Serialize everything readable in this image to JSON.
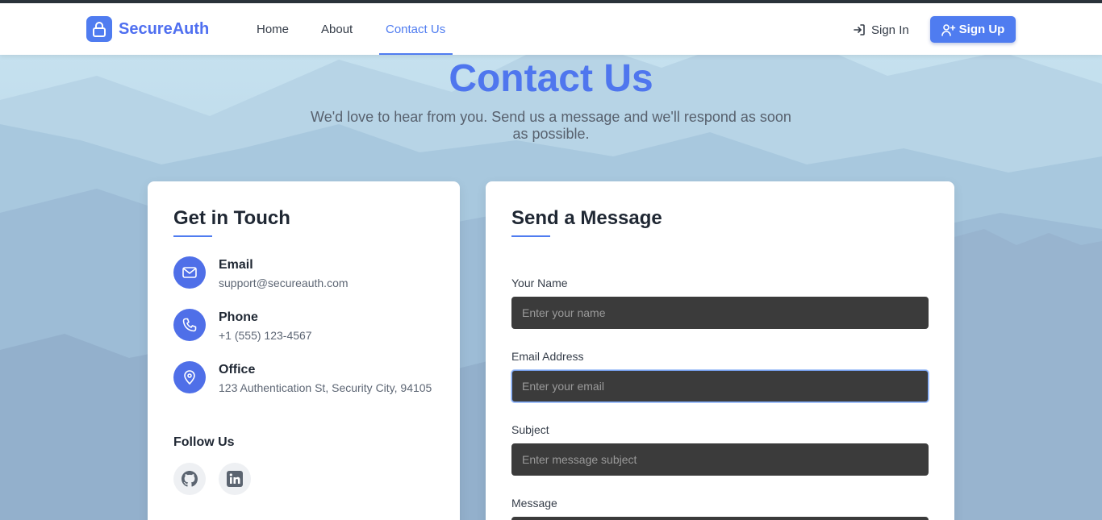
{
  "colors": {
    "accent": "#4f7cf0",
    "title": "#4f76ee",
    "input_bg": "#3b3b3b",
    "page_bg": "#a9c9dd"
  },
  "brand": {
    "name": "SecureAuth",
    "icon": "lock-icon"
  },
  "nav": {
    "links": [
      {
        "label": "Home",
        "active": false
      },
      {
        "label": "About",
        "active": false
      },
      {
        "label": "Contact Us",
        "active": true
      }
    ],
    "sign_in": {
      "label": "Sign In",
      "icon": "sign-in-icon"
    },
    "sign_up": {
      "label": "Sign Up",
      "icon": "user-plus-icon"
    }
  },
  "hero": {
    "title": "Contact Us",
    "subtitle": "We'd love to hear from you. Send us a message and we'll respond as soon as possible."
  },
  "contact_info": {
    "title": "Get in Touch",
    "items": [
      {
        "label": "Email",
        "value": "support@secureauth.com",
        "icon": "mail-icon"
      },
      {
        "label": "Phone",
        "value": "+1 (555) 123-4567",
        "icon": "phone-icon"
      },
      {
        "label": "Office",
        "value": "123 Authentication St, Security City, 94105",
        "icon": "map-pin-icon"
      }
    ],
    "follow_title": "Follow Us",
    "socials": [
      {
        "name": "github-icon"
      },
      {
        "name": "linkedin-icon"
      }
    ]
  },
  "form": {
    "title": "Send a Message",
    "fields": [
      {
        "label": "Your Name",
        "placeholder": "Enter your name",
        "value": ""
      },
      {
        "label": "Email Address",
        "placeholder": "Enter your email",
        "value": "",
        "focused": true
      },
      {
        "label": "Subject",
        "placeholder": "Enter message subject",
        "value": ""
      },
      {
        "label": "Message",
        "placeholder": "",
        "value": ""
      }
    ]
  }
}
